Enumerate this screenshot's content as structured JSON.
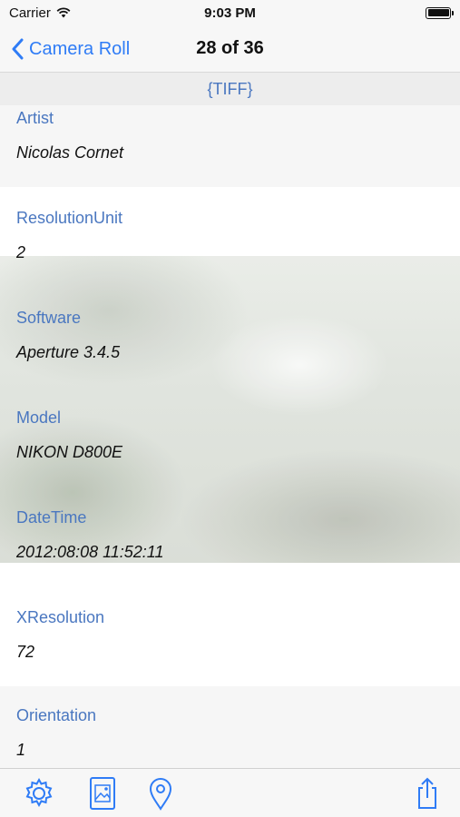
{
  "status": {
    "carrier": "Carrier",
    "time": "9:03 PM"
  },
  "nav": {
    "back_label": "Camera Roll",
    "title": "28 of 36"
  },
  "section": {
    "title": "{TIFF}"
  },
  "rows": [
    {
      "label": "Artist",
      "value": "Nicolas Cornet"
    },
    {
      "label": "ResolutionUnit",
      "value": "2"
    },
    {
      "label": "Software",
      "value": "Aperture 3.4.5"
    },
    {
      "label": "Model",
      "value": "NIKON D800E"
    },
    {
      "label": "DateTime",
      "value": "2012:08:08 11:52:11"
    },
    {
      "label": "XResolution",
      "value": "72"
    },
    {
      "label": "Orientation",
      "value": "1"
    }
  ],
  "toolbar": {
    "icons": [
      "gear-icon",
      "photo-icon",
      "location-pin-icon",
      "share-icon"
    ],
    "accent": "#2f7cf6"
  },
  "colors": {
    "label": "#4a77c0",
    "accent": "#2f7cf6"
  }
}
